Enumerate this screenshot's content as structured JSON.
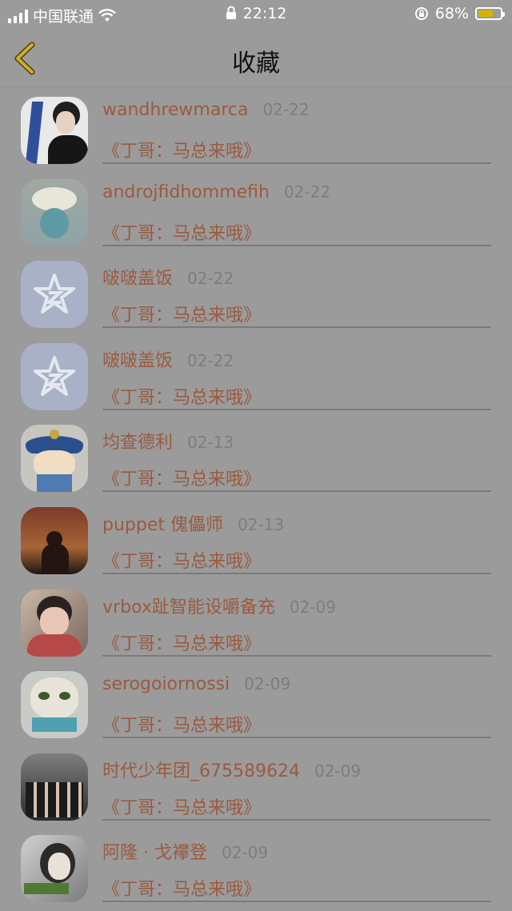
{
  "status_bar": {
    "carrier": "中国联通",
    "time": "22:12",
    "battery": "68%",
    "battery_level": 0.68,
    "icons": [
      "signal-icon",
      "wifi-icon",
      "lock-icon",
      "rotation-lock-icon",
      "battery-icon"
    ]
  },
  "header": {
    "title": "收藏",
    "back_icon": "chevron-left-icon"
  },
  "colors": {
    "name_color": "#9a5a3f",
    "date_color": "#7d7d7d",
    "back_icon_color": "#cfae2c"
  },
  "favorites": [
    {
      "name": "wandhrewmarca",
      "date": "02-22",
      "content": "《丁哥：马总来哦》",
      "avatar": "portrait-avatar"
    },
    {
      "name": "androjfidhommefih",
      "date": "02-22",
      "content": "《丁哥：马总来哦》",
      "avatar": "flower-vase-avatar"
    },
    {
      "name": "啵啵盖饭",
      "date": "02-22",
      "content": "《丁哥：马总来哦》",
      "avatar": "qq-star-avatar"
    },
    {
      "name": "啵啵盖饭",
      "date": "02-22",
      "content": "《丁哥：马总来哦》",
      "avatar": "qq-star-avatar"
    },
    {
      "name": "均查德利",
      "date": "02-13",
      "content": "《丁哥：马总来哦》",
      "avatar": "cartoon-official-avatar"
    },
    {
      "name": "puppet 傀儡师",
      "date": "02-13",
      "content": "《丁哥：马总来哦》",
      "avatar": "sunset-silhouette-avatar"
    },
    {
      "name": "vrbox趾智能设嚼备充",
      "date": "02-09",
      "content": "《丁哥：马总来哦》",
      "avatar": "child-photo-avatar"
    },
    {
      "name": "serogoiornossi",
      "date": "02-09",
      "content": "《丁哥：马总来哦》",
      "avatar": "grumpy-cat-avatar"
    },
    {
      "name": "时代少年团_675589624",
      "date": "02-09",
      "content": "《丁哥：马总来哦》",
      "avatar": "group-photo-avatar"
    },
    {
      "name": "阿隆 · 戈襻登",
      "date": "02-09",
      "content": "《丁哥：马总来哦》",
      "avatar": "girl-portrait-avatar"
    }
  ]
}
